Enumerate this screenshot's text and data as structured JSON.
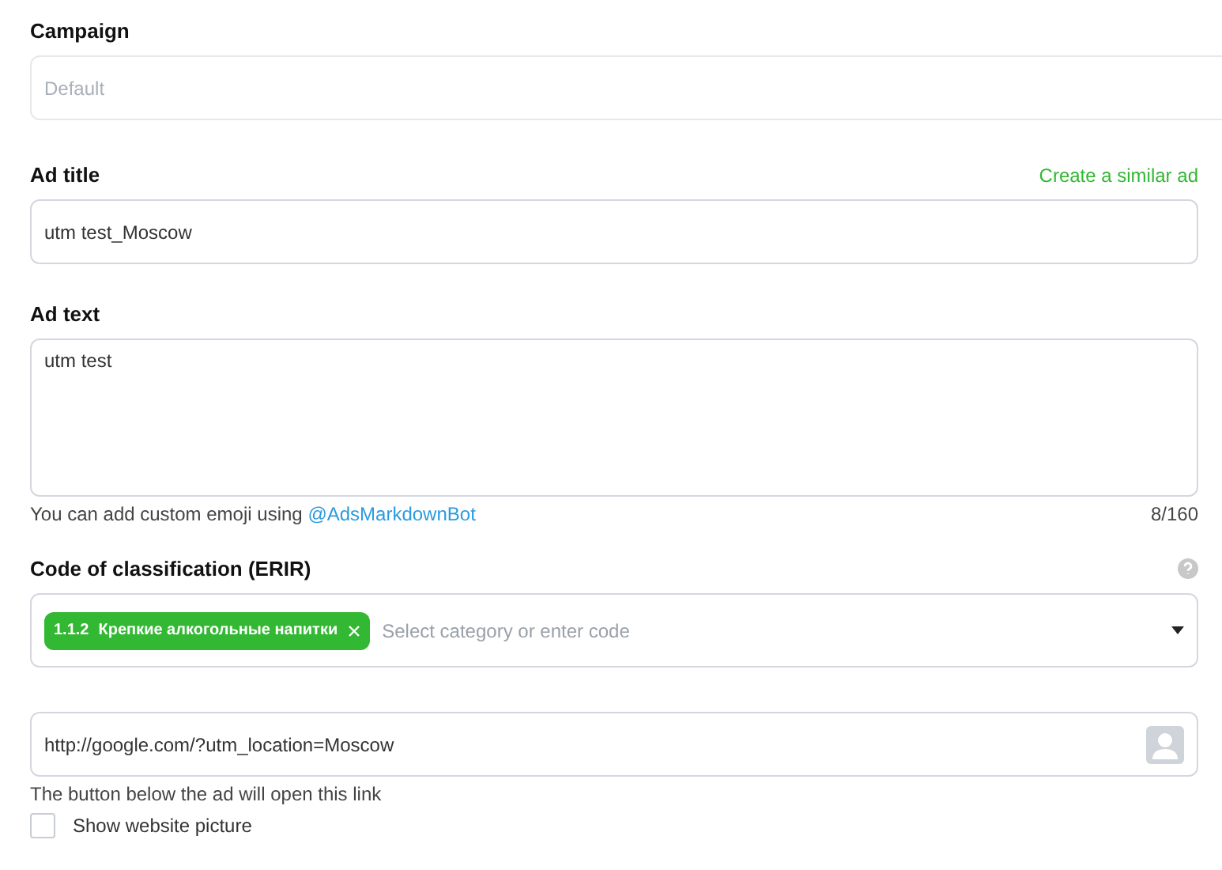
{
  "campaign": {
    "label": "Campaign",
    "placeholder": "Default"
  },
  "ad_title": {
    "label": "Ad title",
    "link": "Create a similar ad",
    "value": "utm test_Moscow"
  },
  "ad_text": {
    "label": "Ad text",
    "value": "utm test",
    "hint": "You can add custom emoji using",
    "hint_link": "@AdsMarkdownBot",
    "counter": "8/160"
  },
  "classification": {
    "label": "Code of classification (ERIR)",
    "tags": [
      {
        "code": "1.1.2",
        "name": "Крепкие алкогольные напитки"
      }
    ],
    "placeholder": "Select category or enter code"
  },
  "link": {
    "value": "http://google.com/?utm_location=Moscow",
    "hint": "The button below the ad will open this link"
  },
  "show_picture": {
    "label": "Show website picture",
    "checked": false
  }
}
